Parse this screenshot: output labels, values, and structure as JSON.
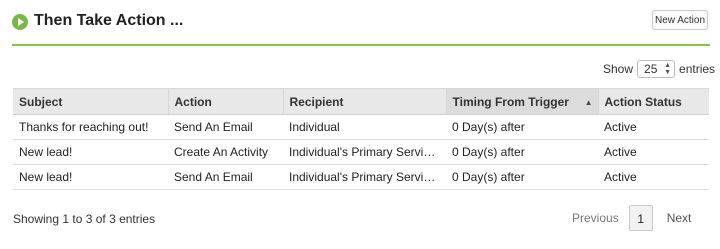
{
  "header": {
    "title": "Then Take Action ...",
    "icon": "play-circle-icon",
    "new_action_label": "New Action",
    "accent_color": "#8bc34a"
  },
  "length": {
    "show_label": "Show",
    "selected": "25",
    "entries_label": "entries"
  },
  "table": {
    "columns": [
      "Subject",
      "Action",
      "Recipient",
      "Timing From Trigger",
      "Action Status"
    ],
    "sorted_column": "Timing From Trigger",
    "rows": [
      {
        "subject": "Thanks for reaching out!",
        "action": "Send An Email",
        "recipient": "Individual",
        "timing": "0 Day(s) after",
        "status": "Active"
      },
      {
        "subject": "New lead!",
        "action": "Create An Activity",
        "recipient": "Individual's Primary Service Rep",
        "timing": "0 Day(s) after",
        "status": "Active"
      },
      {
        "subject": "New lead!",
        "action": "Send An Email",
        "recipient": "Individual's Primary Service Rep",
        "timing": "0 Day(s) after",
        "status": "Active"
      }
    ]
  },
  "footer": {
    "info": "Showing 1 to 3 of 3 entries",
    "previous": "Previous",
    "page": "1",
    "next": "Next"
  }
}
